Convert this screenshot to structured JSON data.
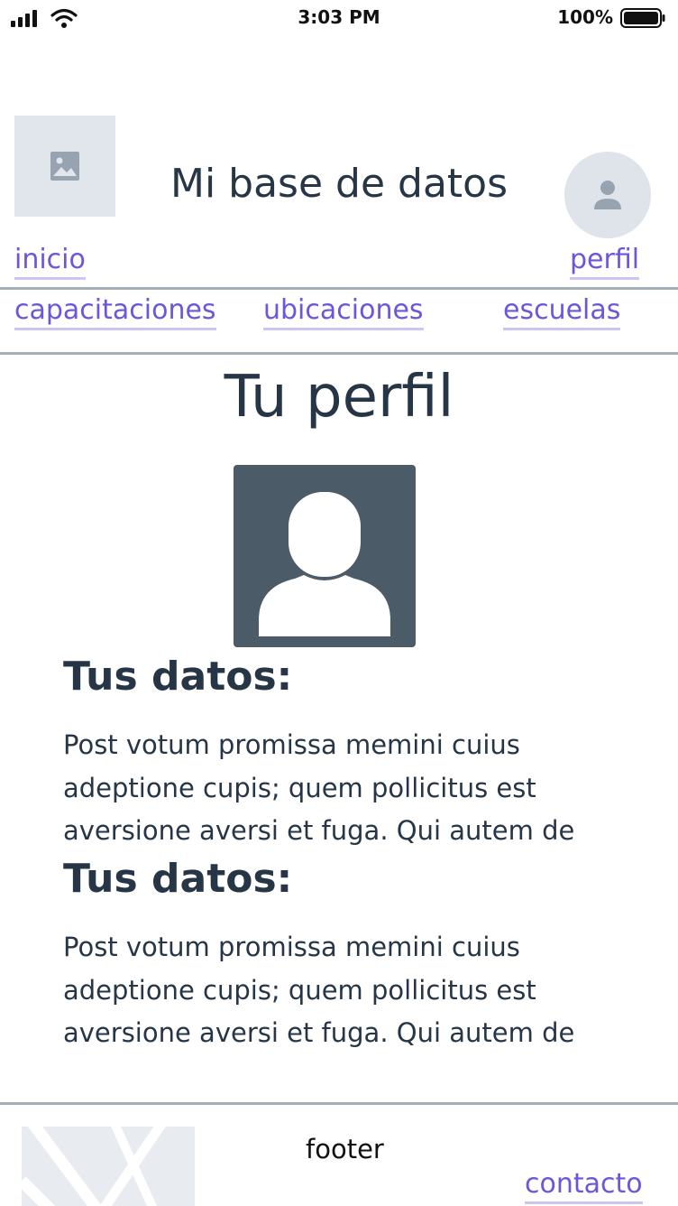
{
  "status_bar": {
    "time": "3:03 PM",
    "battery_percent": "100%",
    "icons": [
      "signal-icon",
      "wifi-icon",
      "battery-icon"
    ]
  },
  "header": {
    "logo_icon": "image-placeholder-icon",
    "title": "Mi base de datos",
    "avatar_icon": "user-icon"
  },
  "nav": {
    "inicio": "inicio",
    "perfil": "perfil",
    "capacitaciones": "capacitaciones",
    "ubicaciones": "ubicaciones",
    "escuelas": "escuelas"
  },
  "main": {
    "title": "Tu perfil",
    "photo_icon": "person-silhouette-icon",
    "sections": [
      {
        "heading": "Tus datos:",
        "lines": [
          "Post votum promissa memini cuius",
          "adeptione cupis; quem pollicitus est",
          "aversione aversi et fuga. Qui autem de"
        ]
      },
      {
        "heading": "Tus datos:",
        "lines": [
          "Post votum promissa memini cuius",
          "adeptione cupis; quem pollicitus est",
          "aversione aversi et fuga. Qui autem de"
        ]
      }
    ]
  },
  "footer": {
    "text": "footer",
    "contact_link": "contacto",
    "map_icon": "map-placeholder-icon"
  },
  "colors": {
    "link": "#6a57de",
    "link_underline": "#cdc6f4",
    "divider": "#a3b0b8",
    "text": "#263646",
    "photo_bg": "#4b5b68",
    "placeholder_bg": "#e1e6ed"
  }
}
